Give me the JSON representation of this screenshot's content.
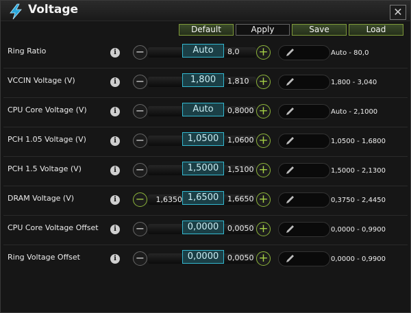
{
  "window": {
    "title": "Voltage",
    "close_glyph": "✕"
  },
  "toolbar": {
    "default_label": "Default",
    "apply_label": "Apply",
    "save_label": "Save",
    "load_label": "Load"
  },
  "icons": {
    "info": "i",
    "minus": "−",
    "plus": "+"
  },
  "colors": {
    "accent_green": "#8db53a",
    "value_border": "#33b9d1",
    "value_fill": "#1b3f46",
    "icon_blue": "#2aa8dc"
  },
  "rows": [
    {
      "label": "Ring Ratio",
      "min": "",
      "value": "Auto",
      "max": "8,0",
      "range": "Auto - 80,0",
      "minus_active": false
    },
    {
      "label": "VCCIN Voltage (V)",
      "min": "",
      "value": "1,800",
      "max": "1,810",
      "range": "1,800 - 3,040",
      "minus_active": false
    },
    {
      "label": "CPU Core Voltage (V)",
      "min": "",
      "value": "Auto",
      "max": "0,8000",
      "range": "Auto - 2,1000",
      "minus_active": false
    },
    {
      "label": "PCH 1.05 Voltage (V)",
      "min": "",
      "value": "1,0500",
      "max": "1,0600",
      "range": "1,0500 - 1,6800",
      "minus_active": false
    },
    {
      "label": "PCH 1.5 Voltage (V)",
      "min": "",
      "value": "1,5000",
      "max": "1,5100",
      "range": "1,5000 - 2,1300",
      "minus_active": false
    },
    {
      "label": "DRAM Voltage (V)",
      "min": "1,6350",
      "value": "1,6500",
      "max": "1,6650",
      "range": "0,3750 - 2,4450",
      "minus_active": true
    },
    {
      "label": "CPU Core Voltage Offset",
      "min": "",
      "value": "0,0000",
      "max": "0,0050",
      "range": "0,0000 - 0,9900",
      "minus_active": false
    },
    {
      "label": "Ring Voltage Offset",
      "min": "",
      "value": "0,0000",
      "max": "0,0050",
      "range": "0,0000 - 0,9900",
      "minus_active": false
    }
  ]
}
